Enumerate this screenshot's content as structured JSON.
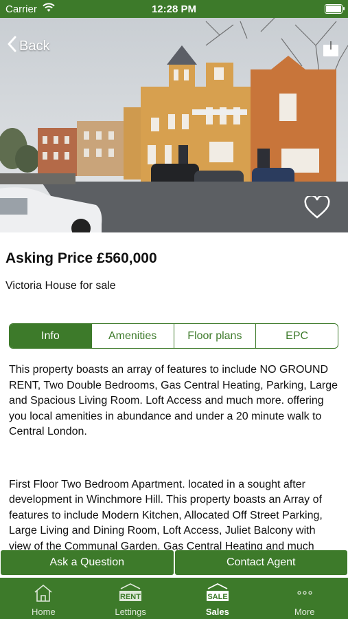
{
  "status": {
    "carrier": "Carrier",
    "time": "12:28 PM"
  },
  "nav": {
    "back_label": "Back",
    "icons": [
      "chevron-left-icon",
      "share-icon",
      "heart-icon"
    ]
  },
  "listing": {
    "price": "Asking Price £560,000",
    "title": "Victoria House for sale"
  },
  "tabs": [
    {
      "label": "Info",
      "active": true
    },
    {
      "label": "Amenities"
    },
    {
      "label": "Floor plans"
    },
    {
      "label": "EPC"
    }
  ],
  "description": [
    "This property boasts an array of features to include NO GROUND RENT, Two Double Bedrooms, Gas Central Heating, Parking, Large and Spacious Living Room. Loft Access and much more. offering you local amenities in abundance and under a 20 minute walk to Central London.",
    "First Floor Two Bedroom Apartment. located in a sought after development in Winchmore Hill. This property boasts an Array of features to include Modern Kitchen, Allocated Off Street Parking, Large Living and Dining Room, Loft Access, Juliet Balcony with view of the Communal Garden, Gas Central Heating and much more."
  ],
  "actions": {
    "ask": "Ask a Question",
    "contact": "Contact Agent"
  },
  "tab_bar": [
    {
      "label": "Home",
      "icon": "home-icon"
    },
    {
      "label": "Lettings",
      "icon": "rent-sign-icon",
      "badge": "RENT"
    },
    {
      "label": "Sales",
      "icon": "sale-sign-icon",
      "badge": "SALE",
      "active": true
    },
    {
      "label": "More",
      "icon": "more-dots-icon"
    }
  ],
  "colors": {
    "brand_green": "#3d7a2a"
  }
}
